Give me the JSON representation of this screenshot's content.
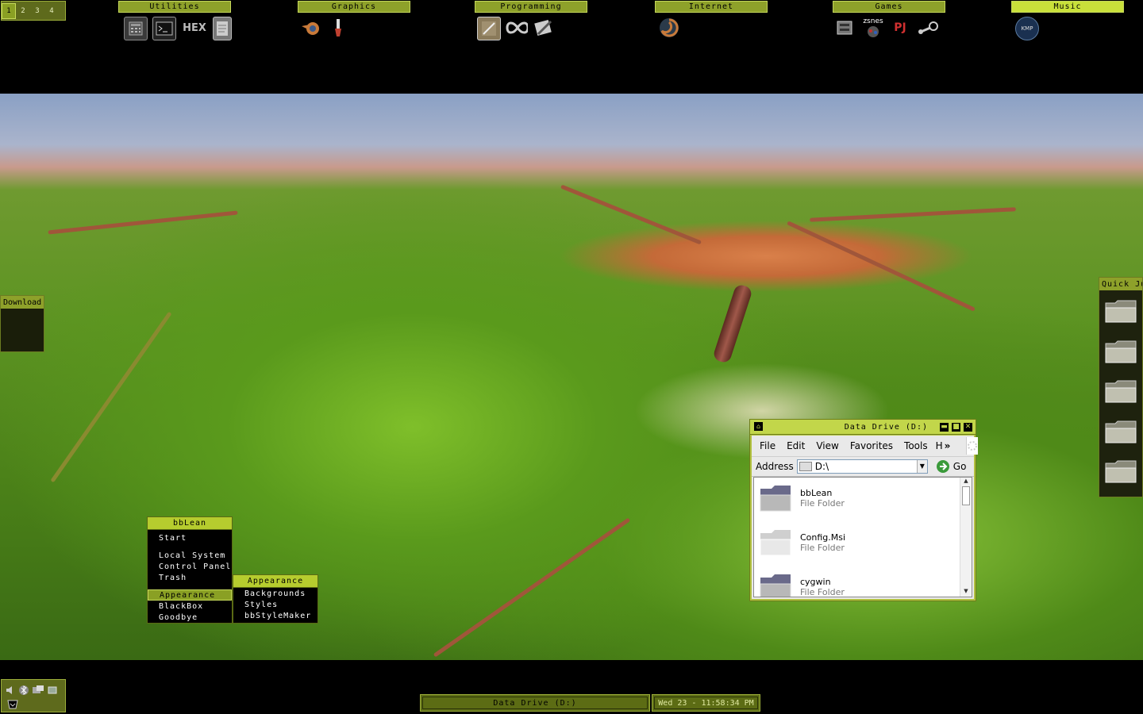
{
  "workspaces": [
    "1",
    "2",
    "3",
    "4"
  ],
  "launcher_groups": [
    {
      "label": "Utilities",
      "active": false,
      "icons": [
        "calculator-icon",
        "terminal-icon",
        "hex-editor-icon",
        "notepad-icon"
      ],
      "icon_text": [
        "",
        "",
        "HEX",
        ""
      ]
    },
    {
      "label": "Graphics",
      "active": false,
      "icons": [
        "blender-icon",
        "paint-brush-icon"
      ],
      "icon_text": [
        "",
        ""
      ]
    },
    {
      "label": "Programming",
      "active": false,
      "icons": [
        "ide-icon",
        "infinity-icon",
        "code-editor-icon"
      ],
      "icon_text": [
        "",
        "",
        ""
      ]
    },
    {
      "label": "Internet",
      "active": false,
      "icons": [
        "browser-swirl-icon"
      ],
      "icon_text": [
        ""
      ]
    },
    {
      "label": "Games",
      "active": false,
      "icons": [
        "console-icon",
        "zsnes-icon",
        "pj64-icon",
        "steam-icon"
      ],
      "icon_text": [
        "",
        "zsnes",
        "PJ",
        ""
      ]
    },
    {
      "label": "Music",
      "active": true,
      "icons": [
        "kmp-player-icon"
      ],
      "icon_text": [
        "KMP"
      ]
    }
  ],
  "download_panel": {
    "title": "Download"
  },
  "quick_panel": {
    "title": "Quick Jump",
    "folder_count": 5
  },
  "bblean_menu": {
    "title": "bbLean",
    "items": [
      "Start",
      "",
      "Local System",
      "Control Panel",
      "Trash",
      "",
      "Appearance",
      "BlackBox",
      "Goodbye"
    ],
    "selected": "Appearance"
  },
  "appearance_menu": {
    "title": "Appearance",
    "items": [
      "Backgrounds",
      "Styles",
      "bbStyleMaker"
    ]
  },
  "explorer": {
    "title": "Data Drive (D:)",
    "menu": [
      "File",
      "Edit",
      "View",
      "Favorites",
      "Tools",
      "H"
    ],
    "overflow": "»",
    "address_label": "Address",
    "address_value": "D:\\",
    "go_label": "Go",
    "items": [
      {
        "name": "bbLean",
        "type": "File Folder"
      },
      {
        "name": "Config.Msi",
        "type": "File Folder"
      },
      {
        "name": "cygwin",
        "type": "File Folder"
      }
    ]
  },
  "taskbar": {
    "task_label": "Data Drive (D:)",
    "clock": "Wed 23 - 11:58:34 PM"
  },
  "colors": {
    "accent": "#8ea12a",
    "accent_bright": "#c9e03a",
    "panel_dark": "#5e6a1c"
  }
}
